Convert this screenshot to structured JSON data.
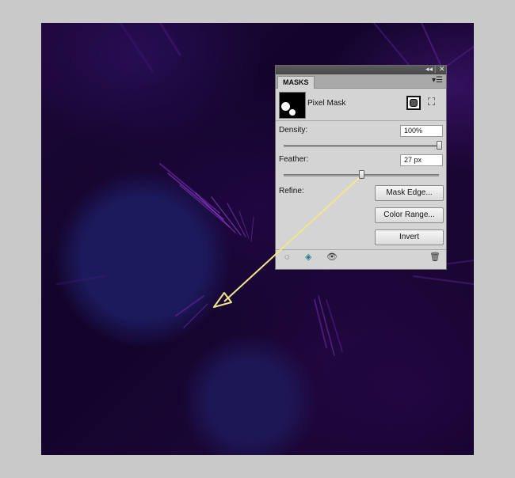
{
  "panel": {
    "tab_label": "MASKS",
    "mask_type_label": "Pixel Mask",
    "density": {
      "label": "Density:",
      "value": "100%",
      "slider": 1.0
    },
    "feather": {
      "label": "Feather:",
      "value": "27 px",
      "slider": 0.5
    },
    "refine_label": "Refine:",
    "buttons": {
      "mask_edge": "Mask Edge...",
      "color_range": "Color Range...",
      "invert": "Invert"
    },
    "titlebar_icons": {
      "collapse": "collapse-icon",
      "close": "close-icon"
    },
    "footer_icons": [
      "load-selection-icon",
      "apply-mask-icon",
      "eye-icon",
      "trash-icon"
    ]
  },
  "colors": {
    "annotation_arrow": "#f0e68c",
    "canvas_background": "#12042a"
  }
}
